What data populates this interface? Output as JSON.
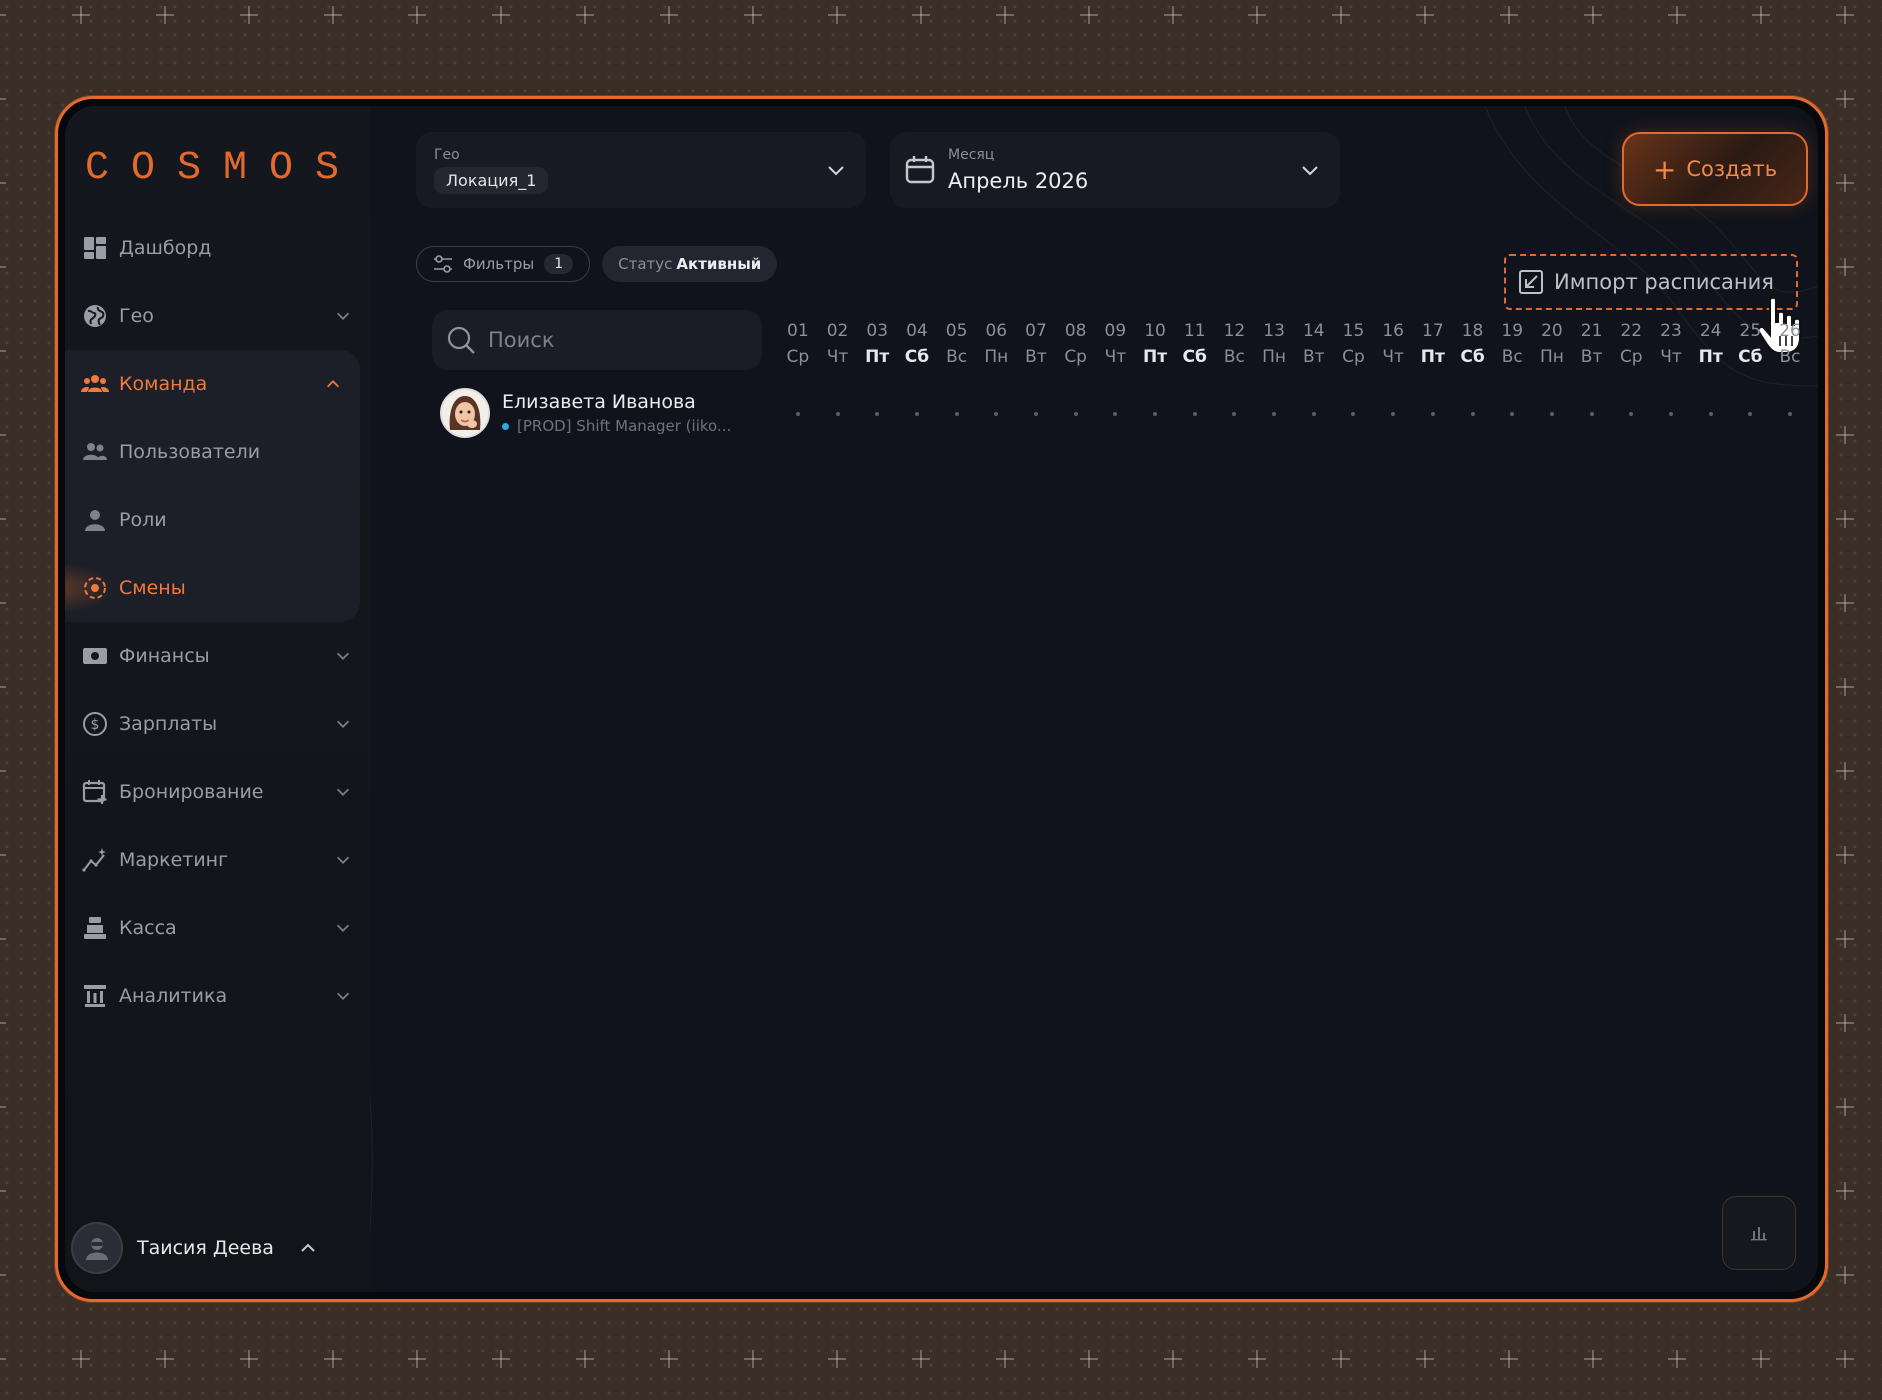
{
  "brand": {
    "logo_text": "COSMOS",
    "accent": "#e36a2c"
  },
  "sidebar": {
    "items": [
      {
        "label": "Дашборд",
        "icon": "dashboard-icon"
      },
      {
        "label": "Гео",
        "icon": "globe-icon"
      },
      {
        "label": "Команда",
        "icon": "team-icon"
      },
      {
        "label": "Пользователи",
        "icon": "users-icon"
      },
      {
        "label": "Роли",
        "icon": "person-icon"
      },
      {
        "label": "Смены",
        "icon": "shift-icon"
      },
      {
        "label": "Финансы",
        "icon": "money-icon"
      },
      {
        "label": "Зарплаты",
        "icon": "dollar-circle-icon"
      },
      {
        "label": "Бронирование",
        "icon": "calendar-plus-icon"
      },
      {
        "label": "Маркетинг",
        "icon": "chart-sparkle-icon"
      },
      {
        "label": "Касса",
        "icon": "register-icon"
      },
      {
        "label": "Аналитика",
        "icon": "analytics-icon"
      }
    ],
    "user": {
      "name": "Таисия Деева"
    }
  },
  "header": {
    "geo": {
      "label": "Гео",
      "value": "Локация_1"
    },
    "month": {
      "label": "Месяц",
      "value": "Апрель 2026"
    },
    "create_label": "Создать"
  },
  "filters": {
    "filters_label": "Фильтры",
    "filters_count": "1",
    "status_key": "Статус",
    "status_value": "Активный",
    "import_label": "Импорт расписания"
  },
  "schedule": {
    "search_placeholder": "Поиск",
    "days": [
      {
        "n": "01",
        "w": "Ср"
      },
      {
        "n": "02",
        "w": "Чт"
      },
      {
        "n": "03",
        "w": "Пт"
      },
      {
        "n": "04",
        "w": "Сб"
      },
      {
        "n": "05",
        "w": "Вс"
      },
      {
        "n": "06",
        "w": "Пн"
      },
      {
        "n": "07",
        "w": "Вт"
      },
      {
        "n": "08",
        "w": "Ср"
      },
      {
        "n": "09",
        "w": "Чт"
      },
      {
        "n": "10",
        "w": "Пт"
      },
      {
        "n": "11",
        "w": "Сб"
      },
      {
        "n": "12",
        "w": "Вс"
      },
      {
        "n": "13",
        "w": "Пн"
      },
      {
        "n": "14",
        "w": "Вт"
      },
      {
        "n": "15",
        "w": "Ср"
      },
      {
        "n": "16",
        "w": "Чт"
      },
      {
        "n": "17",
        "w": "Пт"
      },
      {
        "n": "18",
        "w": "Сб"
      },
      {
        "n": "19",
        "w": "Вс"
      },
      {
        "n": "20",
        "w": "Пн"
      },
      {
        "n": "21",
        "w": "Вт"
      },
      {
        "n": "22",
        "w": "Ср"
      },
      {
        "n": "23",
        "w": "Чт"
      },
      {
        "n": "24",
        "w": "Пт"
      },
      {
        "n": "25",
        "w": "Сб"
      },
      {
        "n": "26",
        "w": "Вс"
      }
    ],
    "employee": {
      "name": "Елизавета Иванова",
      "role": "[PROD] Shift Manager (iiko..."
    }
  }
}
